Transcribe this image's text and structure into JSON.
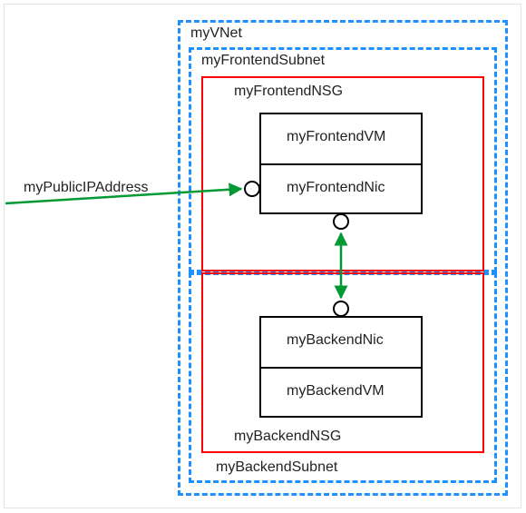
{
  "diagram": {
    "external_label": "myPublicIPAddress",
    "vnet": {
      "label": "myVNet",
      "frontend_subnet": {
        "label": "myFrontendSubnet",
        "nsg": {
          "label": "myFrontendNSG",
          "vm": "myFrontendVM",
          "nic": "myFrontendNic"
        }
      },
      "backend_subnet": {
        "label": "myBackendSubnet",
        "nsg": {
          "label": "myBackendNSG",
          "nic": "myBackendNic",
          "vm": "myBackendVM"
        }
      }
    }
  },
  "colors": {
    "dashed": "#1e90ff",
    "nsg": "#ff0000",
    "box": "#000000",
    "arrow": "#009933"
  }
}
